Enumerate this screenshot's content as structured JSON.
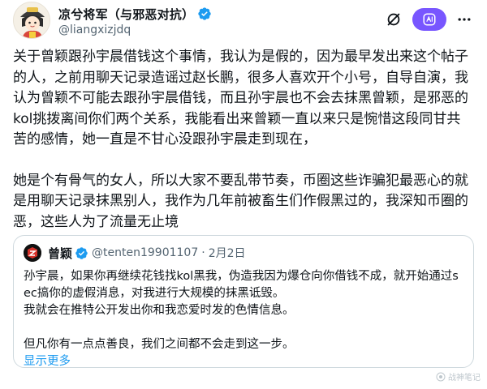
{
  "author": {
    "display_name": "凉兮将军（与邪恶对抗）",
    "handle": "@liangxizjdq",
    "verified_color": "#1d9bf0"
  },
  "header_actions": {
    "mute_icon": "mute-icon",
    "grok_icon": "grok-icon",
    "more_icon": "more-icon",
    "grok_color": "#7856ff"
  },
  "post": {
    "paragraphs": [
      "关于曾颖跟孙宇晨借钱这个事情，我认为是假的，因为最早发出来这个帖子的人，之前用聊天记录造谣过赵长鹏，很多人喜欢开个小号，自导自演，我认为曾颖不可能去跟孙宇晨借钱，而且孙宇晨也不会去抹黑曾颖，是邪恶的kol挑拨离间你们两个关系，我能看出来曾颖一直以来只是惋惜这段同甘共苦的感情，她一直是不甘心没跟孙宇晨走到现在，",
      "她是个有骨气的女人，所以大家不要乱带节奏，币圈这些诈骗犯最恶心的就是用聊天记录抹黑别人，我作为几年前被畜生们作假黑过的，我深知币圈的恶，这些人为了流量无止境"
    ]
  },
  "quote": {
    "display_name": "曾颖",
    "handle": "@tenten19901107",
    "separator": "·",
    "date": "2月2日",
    "lines": [
      "孙宇晨，如果你再继续花钱找kol黑我，伪造我因为爆仓向你借钱不成，就开始通过sec搞你的虚假消息，对我进行大规模的抹黑诋毁。",
      "我就会在推特公开发出你和我恋爱时发的色情信息。",
      "但凡你有一点点善良，我们之间都不会走到这一步。"
    ],
    "show_more": "显示更多"
  },
  "watermark": {
    "text": "战神笔记"
  }
}
